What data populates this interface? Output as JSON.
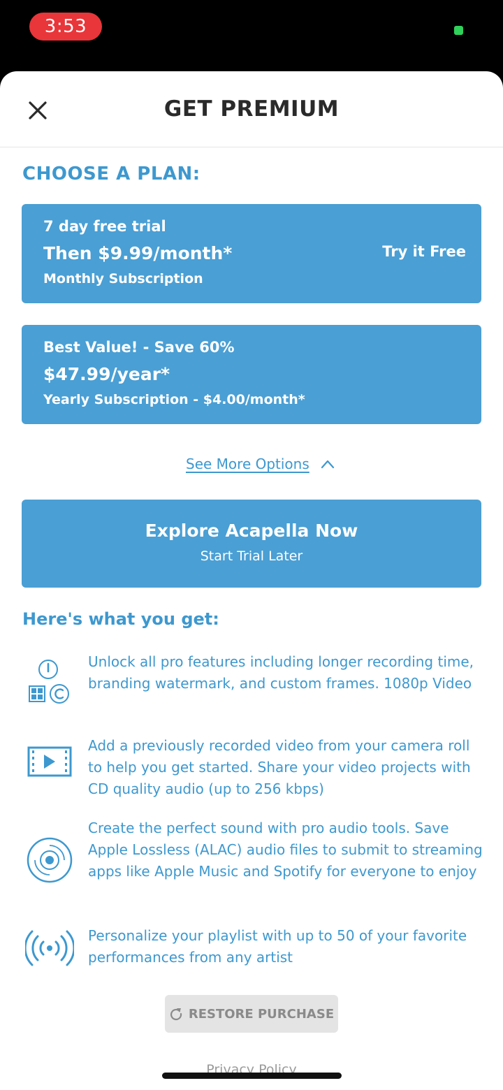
{
  "status_bar": {
    "time": "3:53",
    "time_pill_color": "#e8363a",
    "battery_color": "#2fd15a"
  },
  "header": {
    "title": "GET PREMIUM",
    "close_icon": "close-icon"
  },
  "choose_plan": {
    "heading": "CHOOSE A PLAN:",
    "plans": [
      {
        "line1": "7 day free trial",
        "line2": "Then $9.99/month*",
        "line3": "Monthly Subscription",
        "cta": "Try it Free"
      },
      {
        "line1": "Best Value! - Save 60%",
        "line2": "$47.99/year*",
        "line3": "Yearly Subscription - $4.00/month*"
      }
    ],
    "see_more": "See More Options"
  },
  "explore": {
    "title": "Explore Acapella Now",
    "subtitle": "Start Trial Later"
  },
  "benefits": {
    "heading": "Here's what you get:",
    "items": [
      {
        "icon": "pro-features-icon",
        "text": "Unlock all pro features including longer recording time, branding watermark, and custom frames. 1080p Video"
      },
      {
        "icon": "video-film-icon",
        "text": "Add a previously recorded video from your camera roll to help you get started. Share your video projects with CD quality audio (up to 256 kbps)"
      },
      {
        "icon": "disc-icon",
        "text": "Create the perfect sound with pro audio tools. Save Apple Lossless (ALAC) audio files to submit to streaming apps like Apple Music and Spotify for everyone to enjoy"
      },
      {
        "icon": "broadcast-icon",
        "text": "Personalize your playlist with up to 50 of your favorite performances from any artist"
      }
    ]
  },
  "footer": {
    "restore": "RESTORE PURCHASE",
    "privacy": "Privacy Policy"
  },
  "colors": {
    "accent": "#4a9fd4",
    "accent_text": "#3d98cf",
    "title_text": "#2a2a2a"
  }
}
